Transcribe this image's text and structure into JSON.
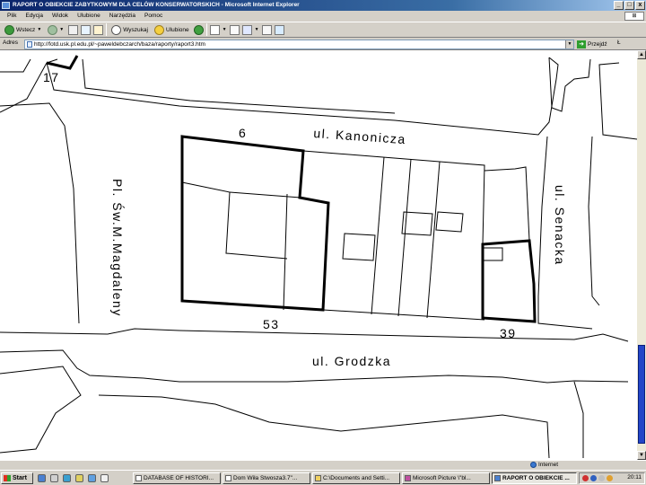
{
  "window": {
    "title": "RAPORT O OBIEKCIE ZABYTKOWYM DLA CELÓW KONSERWATORSKICH - Microsoft Internet Explorer",
    "controls": [
      "_",
      "□",
      "x"
    ]
  },
  "menu": [
    "Plik",
    "Edycja",
    "Widok",
    "Ulubione",
    "Narzędzia",
    "Pomoc"
  ],
  "toolbar": {
    "back": "Wstecz",
    "search": "Wyszukaj",
    "favorites": "Ulubione"
  },
  "address": {
    "label": "Adres",
    "url": "http://fotd.usk.pl.edu.pl/~paweldebczarch/baza/raporty/raport3.htm",
    "go": "Przejdź",
    "links": "Ł"
  },
  "map": {
    "streets": {
      "top": "ul. Kanonicza",
      "left": "Pl. Św.M.Magdaleny",
      "right": "ul. Senacka",
      "bottom": "ul. Grodzka"
    },
    "numbers": {
      "n17": "17",
      "n6": "6",
      "n53": "53",
      "n39": "39"
    }
  },
  "status": {
    "zone": "Internet"
  },
  "taskbar": {
    "start": "Start",
    "tasks": [
      "DATABASE OF HISTORI...",
      "Dom Wiła Stwosza3.7\"...",
      "C:\\Documents and Setti...",
      "Microsoft Picture \\\"bl...",
      "RAPORT O OBIEKCIE ..."
    ],
    "clock": "20:11"
  },
  "colors": {
    "titlebar_start": "#0a246a",
    "titlebar_end": "#a6caf0",
    "chrome": "#d4d0c8",
    "scroll_thumb": "#2346c8"
  }
}
